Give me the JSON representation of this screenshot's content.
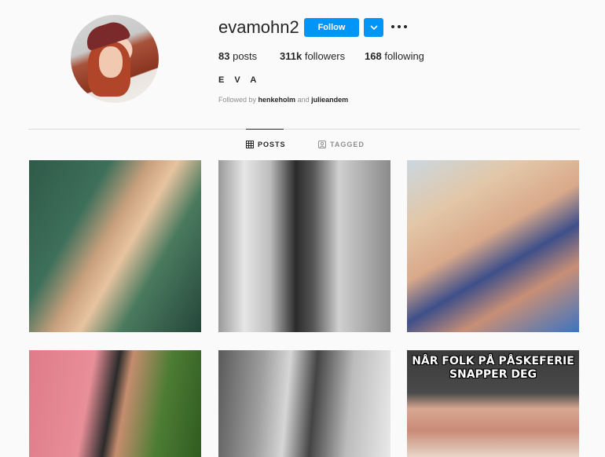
{
  "profile": {
    "username": "evamohn2",
    "follow_label": "Follow",
    "full_name": "E V A",
    "stats": {
      "posts_count": "83",
      "posts_label": "posts",
      "followers_count": "311k",
      "followers_label": "followers",
      "following_count": "168",
      "following_label": "following"
    },
    "followed_by": {
      "prefix": "Followed by",
      "user1": "henkeholm",
      "joiner": "and",
      "user2": "julieandem"
    }
  },
  "tabs": {
    "posts": "POSTS",
    "tagged": "TAGGED"
  },
  "posts": {
    "meme_text": "NÅR FOLK PÅ PÅSKEFERIE SNAPPER DEG"
  },
  "colors": {
    "accent": "#0095f6",
    "text": "#262626",
    "secondary_text": "#8e8e8e",
    "divider": "#dbdbdb",
    "background": "#fafafa"
  }
}
